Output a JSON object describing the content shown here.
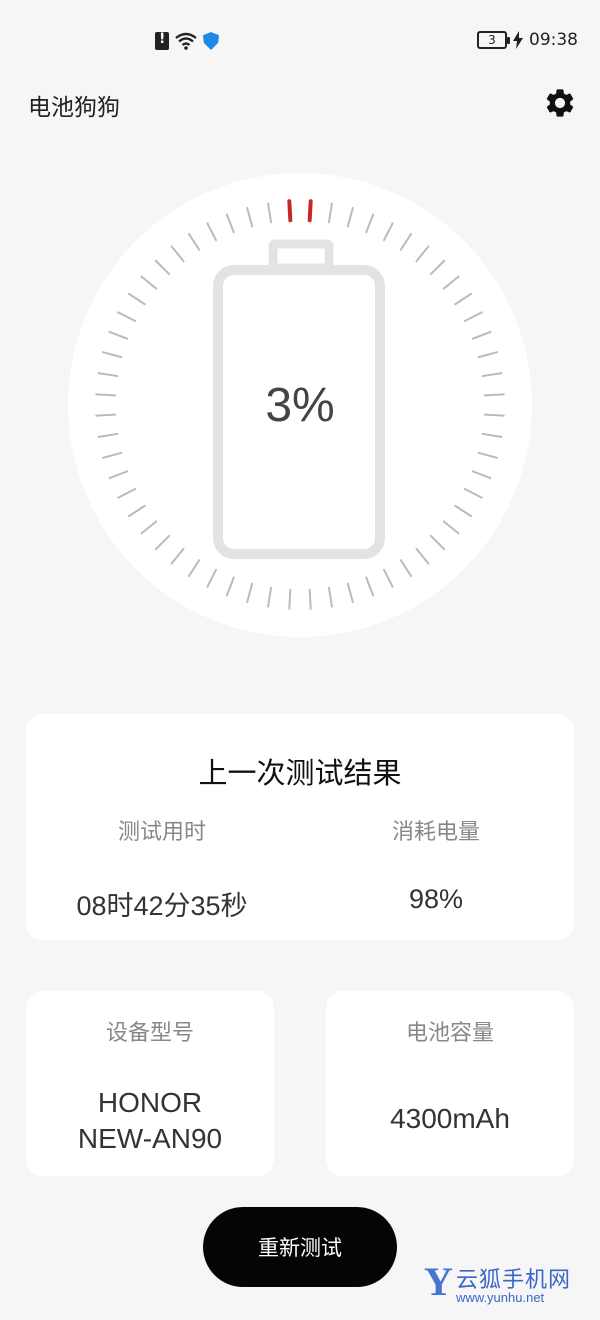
{
  "status_bar": {
    "time": "09:38",
    "battery_level": "3",
    "icons": [
      "sim-alert-icon",
      "wifi-icon",
      "shield-icon",
      "battery-icon",
      "charging-bolt-icon"
    ]
  },
  "app": {
    "title": "电池狗狗",
    "settings_icon": "gear-icon"
  },
  "gauge": {
    "percent_label": "3%",
    "level_fraction": 0.03,
    "tick_color": "#bbbbbb",
    "active_tick_color": "#c62828"
  },
  "last_result": {
    "title": "上一次测试结果",
    "time_label": "测试用时",
    "time_value": "08时42分35秒",
    "consume_label": "消耗电量",
    "consume_value": "98%"
  },
  "device": {
    "label": "设备型号",
    "value_line1": "HONOR",
    "value_line2": "NEW-AN90"
  },
  "capacity": {
    "label": "电池容量",
    "value": "4300mAh"
  },
  "actions": {
    "retest_label": "重新测试"
  },
  "watermark": {
    "logo": "Y",
    "name": "云狐手机网",
    "url": "www.yunhu.net"
  }
}
